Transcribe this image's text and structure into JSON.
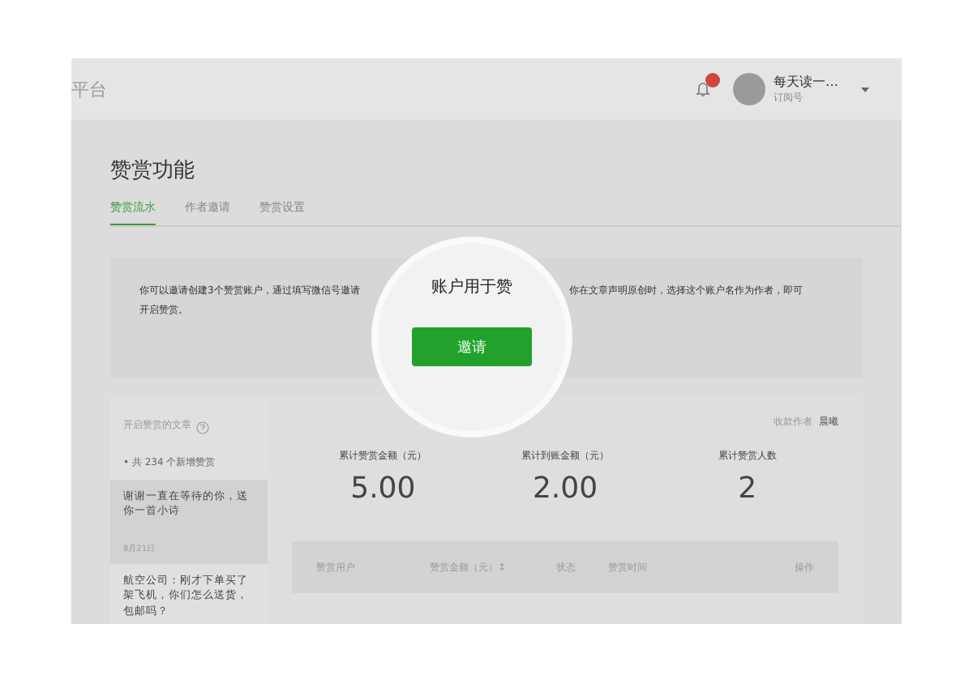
{
  "header": {
    "brand": "平台",
    "notifications": {
      "unread": true
    },
    "account": {
      "name": "每天读一…",
      "type": "订阅号"
    }
  },
  "page": {
    "title": "赞赏功能",
    "tabs": [
      {
        "label": "赞赏流水",
        "selected": true
      },
      {
        "label": "作者邀请",
        "selected": false
      },
      {
        "label": "赞赏设置",
        "selected": false
      }
    ]
  },
  "notice": {
    "text_left": "你可以邀请创建3个赞赏账户，通过填写微信号邀请",
    "text_right": "你在文章声明原创时，选择这个账户名作为作者，即可",
    "text_end": "开启赞赏。"
  },
  "magnifier": {
    "caption": "账户用于赞",
    "button": "邀请"
  },
  "articles": {
    "title": "开启赞赏的文章",
    "summary": "• 共 234 个新增赞赏",
    "items": [
      {
        "title": "谢谢一直在等待的你，送你一首小诗",
        "date": "8月21日",
        "selected": true
      },
      {
        "title": "航空公司：刚才下单买了架飞机，你们怎么送货，包邮吗？",
        "selected": false
      }
    ]
  },
  "payee": {
    "label": "收款作者",
    "name": "晨曦"
  },
  "stats": [
    {
      "label": "累计赞赏金额（元）",
      "value": "5.00"
    },
    {
      "label": "累计到账金额（元）",
      "value": "2.00"
    },
    {
      "label": "累计赞赏人数",
      "value": "2"
    }
  ],
  "table": {
    "columns": [
      "赞赏用户",
      "赞赏金额（元）↕",
      "状态",
      "赞赏时间",
      "操作"
    ]
  }
}
